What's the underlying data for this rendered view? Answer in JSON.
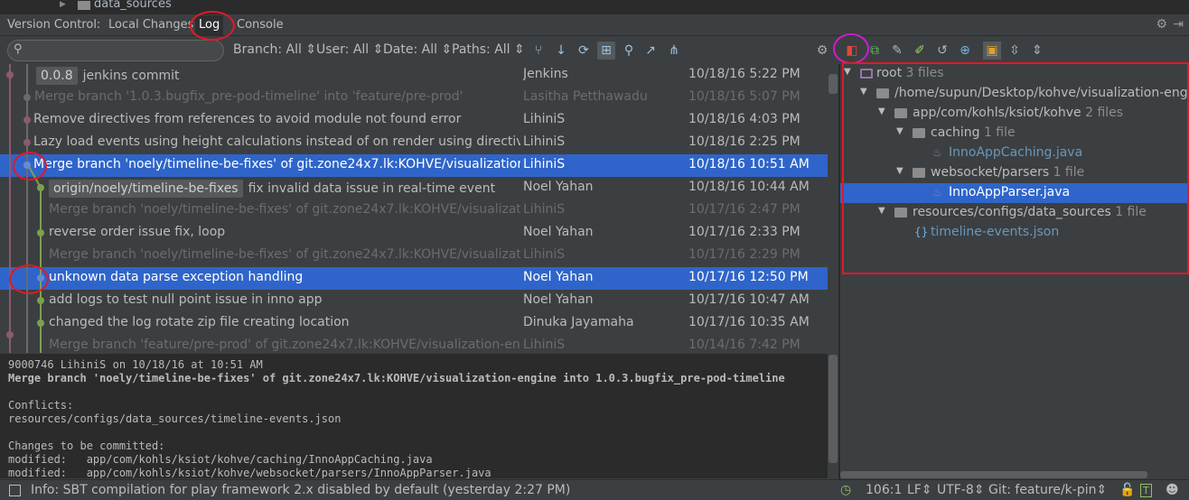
{
  "top_strip": {
    "folder_label": "data_sources"
  },
  "tabs": [
    {
      "label": "Version Control:",
      "active": false
    },
    {
      "label": "Local Changes",
      "active": false
    },
    {
      "label": "Log",
      "active": true
    },
    {
      "label": "Console",
      "active": false
    }
  ],
  "filters": {
    "search_placeholder": "",
    "branch": "Branch: All",
    "user": "User: All",
    "date": "Date: All",
    "paths": "Paths: All"
  },
  "commits": [
    {
      "ref": "0.0.8",
      "message": "jenkins commit",
      "author": "Jenkins",
      "date": "10/18/16 5:22 PM",
      "dim": false,
      "selected": false
    },
    {
      "ref": "",
      "message": "Merge branch '1.0.3.bugfix_pre-pod-timeline' into 'feature/pre-prod'",
      "author": "Lasitha Petthawadu",
      "date": "10/18/16 5:07 PM",
      "dim": true,
      "selected": false
    },
    {
      "ref": "",
      "message": "Remove directives from references to avoid module not found error",
      "author": "LihiniS",
      "date": "10/18/16 4:03 PM",
      "dim": false,
      "selected": false
    },
    {
      "ref": "",
      "message": "Lazy load events using height calculations instead of on render using directives",
      "author": "LihiniS",
      "date": "10/18/16 2:25 PM",
      "dim": false,
      "selected": false
    },
    {
      "ref": "",
      "message": "Merge branch 'noely/timeline-be-fixes' of git.zone24x7.lk:KOHVE/visualization-engine",
      "author": "LihiniS",
      "date": "10/18/16 10:51 AM",
      "dim": false,
      "selected": true
    },
    {
      "ref": "origin/noely/timeline-be-fixes",
      "message": "fix invalid data issue in real-time event",
      "author": "Noel Yahan",
      "date": "10/18/16 10:44 AM",
      "dim": false,
      "selected": false
    },
    {
      "ref": "",
      "message": "Merge branch 'noely/timeline-be-fixes' of git.zone24x7.lk:KOHVE/visualization-engine",
      "author": "LihiniS",
      "date": "10/17/16 2:47 PM",
      "dim": true,
      "selected": false
    },
    {
      "ref": "",
      "message": "reverse order issue fix, loop",
      "author": "Noel Yahan",
      "date": "10/17/16 2:33 PM",
      "dim": false,
      "selected": false
    },
    {
      "ref": "",
      "message": "Merge branch 'noely/timeline-be-fixes' of git.zone24x7.lk:KOHVE/visualization-engine",
      "author": "LihiniS",
      "date": "10/17/16 2:29 PM",
      "dim": true,
      "selected": false
    },
    {
      "ref": "",
      "message": "unknown data parse exception handling",
      "author": "Noel Yahan",
      "date": "10/17/16 12:50 PM",
      "dim": false,
      "selected": true
    },
    {
      "ref": "",
      "message": "add logs to test null point issue in inno app",
      "author": "Noel Yahan",
      "date": "10/17/16 10:47 AM",
      "dim": false,
      "selected": false
    },
    {
      "ref": "",
      "message": "changed the log rotate zip file creating location",
      "author": "Dinuka Jayamaha",
      "date": "10/17/16 10:35 AM",
      "dim": false,
      "selected": false
    },
    {
      "ref": "",
      "message": "Merge branch 'feature/pre-prod' of git.zone24x7.lk:KOHVE/visualization-engine",
      "author": "LihiniS",
      "date": "10/14/16 7:42 PM",
      "dim": true,
      "selected": false
    }
  ],
  "details": {
    "header": "9000746 LihiniS on 10/18/16 at 10:51 AM",
    "subject": "Merge branch 'noely/timeline-be-fixes' of git.zone24x7.lk:KOHVE/visualization-engine into 1.0.3.bugfix_pre-pod-timeline",
    "conflicts_label": "Conflicts:",
    "conflict_file": "resources/configs/data_sources/timeline-events.json",
    "changes_label": "Changes to be committed:",
    "modified_1": "modified:   app/com/kohls/ksiot/kohve/caching/InnoAppCaching.java",
    "modified_2": "modified:   app/com/kohls/ksiot/kohve/websocket/parsers/InnoAppParser.java"
  },
  "tree": {
    "root_label": "root",
    "root_count": "3 files",
    "path_label": "/home/supun/Desktop/kohve/visualization-engine",
    "pkg_label": "app/com/kohls/ksiot/kohve",
    "pkg_count": "2 files",
    "caching_label": "caching",
    "caching_count": "1 file",
    "caching_file": "InnoAppCaching.java",
    "websocket_label": "websocket/parsers",
    "websocket_count": "1 file",
    "websocket_file": "InnoAppParser.java",
    "resources_label": "resources/configs/data_sources",
    "resources_count": "1 file",
    "json_file": "timeline-events.json"
  },
  "status": {
    "info": "Info: SBT compilation for play framework 2.x disabled by default (yesterday 2:27 PM)",
    "position": "106:1",
    "line_sep": "LF",
    "encoding": "UTF-8",
    "git": "Git: feature/k-pin"
  },
  "colors": {
    "selection": "#2f65ca",
    "annotation_red": "#e0192a",
    "annotation_magenta": "#d419d4",
    "modified_file": "#6897bb"
  }
}
